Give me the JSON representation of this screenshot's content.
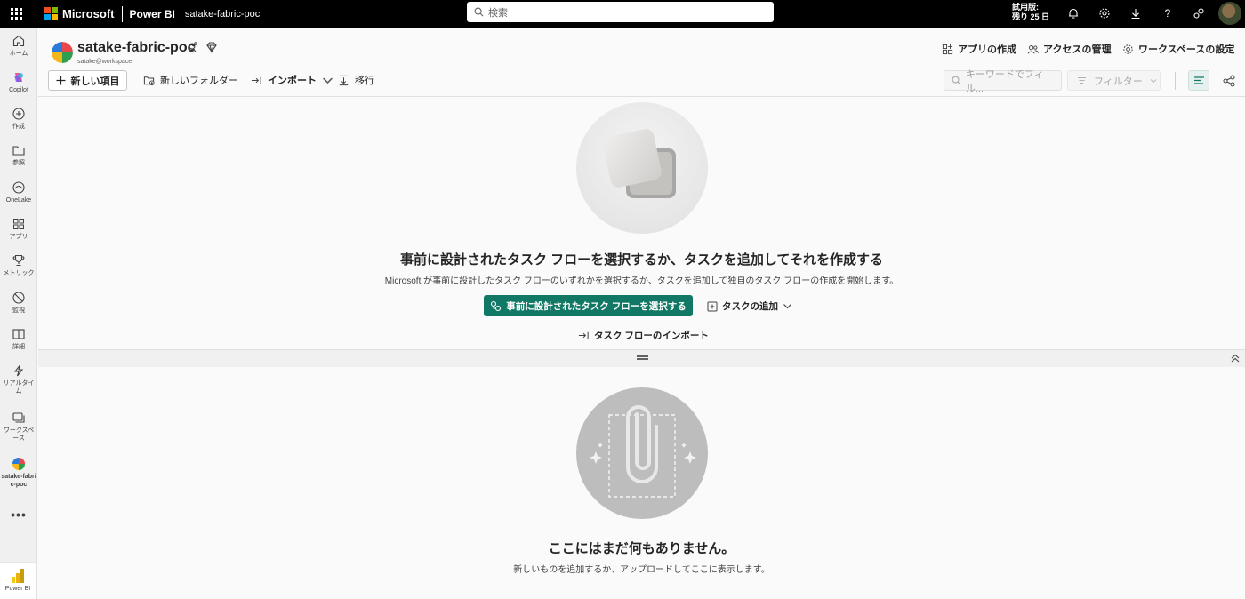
{
  "topbar": {
    "brand": "Microsoft",
    "product": "Power BI",
    "workspace": "satake-fabric-poc",
    "search_placeholder": "検索",
    "trial_line1": "試用版:",
    "trial_line2": "残り 25 日",
    "icons": [
      "app-launcher-icon",
      "notification-bell-icon",
      "settings-gear-icon",
      "download-icon",
      "help-icon",
      "share-feedback-icon"
    ]
  },
  "leftnav": {
    "items": [
      {
        "label": "ホーム",
        "icon": "home-icon"
      },
      {
        "label": "Copilot",
        "icon": "copilot-icon"
      },
      {
        "label": "作成",
        "icon": "create-plus-icon"
      },
      {
        "label": "参照",
        "icon": "browse-folder-icon"
      },
      {
        "label": "OneLake",
        "icon": "onelake-icon"
      },
      {
        "label": "アプリ",
        "icon": "apps-icon"
      },
      {
        "label": "メトリック",
        "icon": "metrics-trophy-icon"
      },
      {
        "label": "監視",
        "icon": "monitor-icon"
      },
      {
        "label": "詳細",
        "icon": "learn-book-icon"
      },
      {
        "label": "リアルタイム",
        "icon": "realtime-bolt-icon"
      },
      {
        "label": "ワークスペース",
        "icon": "workspaces-icon"
      },
      {
        "label": "satake-fabric-poc",
        "icon": "workspace-logo-icon"
      }
    ],
    "more": "•••",
    "footer_label": "Power BI"
  },
  "header": {
    "title": "satake-fabric-poc",
    "subtitle": "satake@workspace",
    "actions": {
      "create_app": "アプリの作成",
      "manage_access": "アクセスの管理",
      "workspace_settings": "ワークスペースの設定"
    }
  },
  "toolbar": {
    "new_item": "新しい項目",
    "new_folder": "新しいフォルダー",
    "import": "インポート",
    "migrate": "移行",
    "keyword_placeholder": "キーワードでフィル...",
    "filter": "フィルター"
  },
  "taskflow": {
    "title": "事前に設計されたタスク フローを選択するか、タスクを追加してそれを作成する",
    "description": "Microsoft が事前に設計したタスク フローのいずれかを選択するか、タスクを追加して独自のタスク フローの作成を開始します。",
    "primary_button": "事前に設計されたタスク フローを選択する",
    "add_task": "タスクの追加",
    "import_task_flow": "タスク フローのインポート"
  },
  "empty": {
    "title": "ここにはまだ何もありません。",
    "description": "新しいものを追加するか、アップロードしてここに表示します。"
  },
  "colors": {
    "topbar": "#000000",
    "accent": "#117865",
    "powerbi_yellow": "#F2C811"
  }
}
